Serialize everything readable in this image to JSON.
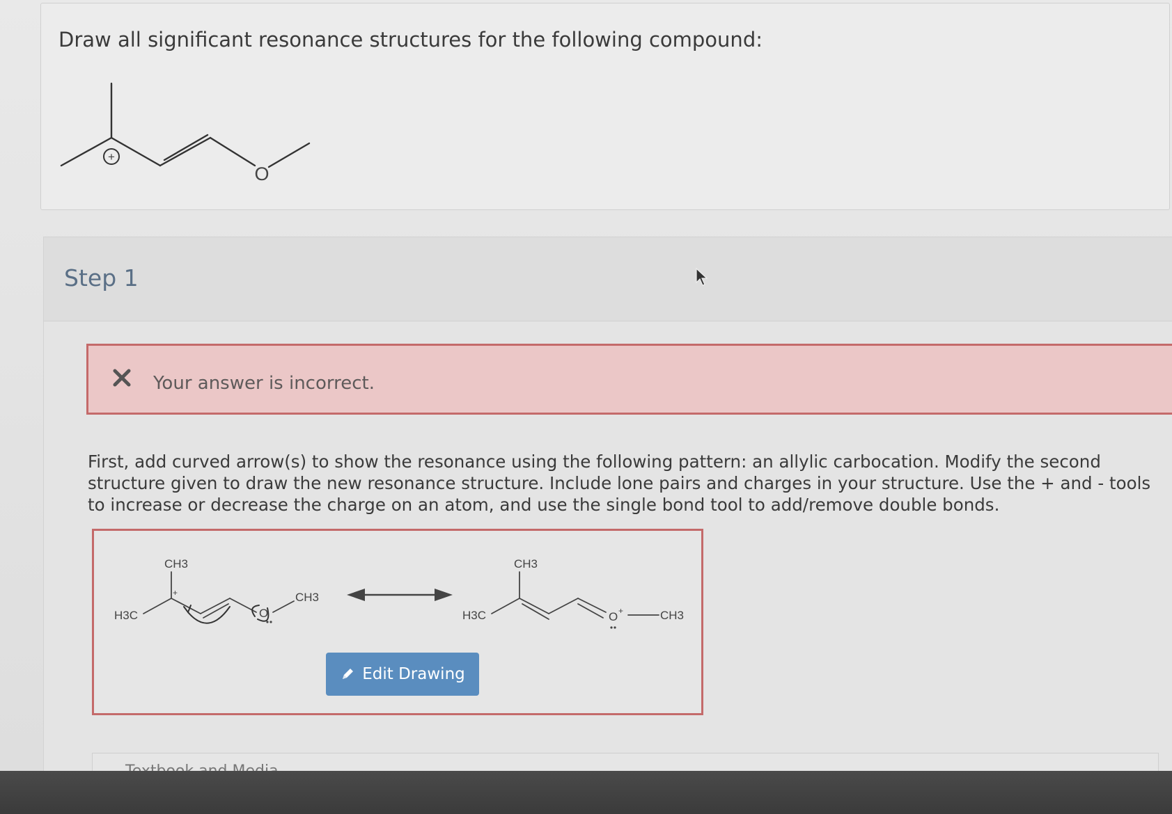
{
  "question": {
    "prompt": "Draw all significant resonance structures for the following compound:"
  },
  "step": {
    "title": "Step 1"
  },
  "feedback": {
    "message": "Your answer is incorrect."
  },
  "instructions": {
    "text": "First, add curved arrow(s) to show the resonance using the following pattern: an allylic carbocation. Modify the second structure given to draw the new resonance structure. Include lone pairs and charges in your structure. Use the + and - tools to increase or decrease the charge on an atom, and use the single bond tool to add/remove double bonds."
  },
  "drawing": {
    "structure1": {
      "ch3_top": "CH3",
      "h3c_left": "H3C",
      "ch3_right": "CH3",
      "oxygen": "O",
      "plus": "+"
    },
    "structure2": {
      "ch3_top": "CH3",
      "h3c_left": "H3C",
      "ch3_right": "CH3",
      "oxygen": "O",
      "plus": "+"
    },
    "edit_button_label": "Edit Drawing"
  },
  "main_molecule": {
    "oxygen": "O",
    "plus": "+"
  },
  "next_section": {
    "label": "Textbook and Media"
  },
  "colors": {
    "error_border": "#c46a6a",
    "error_bg": "#ebc7c7",
    "button_bg": "#5a8dbf",
    "step_title": "#5a6f86"
  }
}
